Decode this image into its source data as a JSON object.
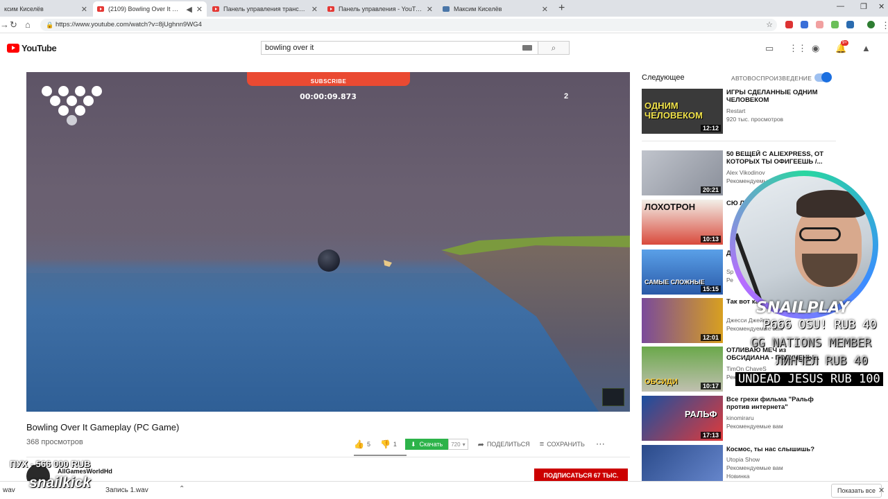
{
  "browser": {
    "tabs": [
      {
        "title": "ксим Киселёв"
      },
      {
        "title": "(2109) Bowling Over It Gam"
      },
      {
        "title": "Панель управления трансляция"
      },
      {
        "title": "Панель управления - YouTube"
      },
      {
        "title": "Максим Киселёв"
      }
    ],
    "tab_close": "✕",
    "new_tab": "+",
    "url": "https://www.youtube.com/watch?v=8jUghnn9WG4",
    "window_minimize": "—",
    "window_restore": "❐",
    "window_close": "✕"
  },
  "youtube": {
    "logo_text": "YouTube",
    "search_value": "bowling over it"
  },
  "player": {
    "subscribe_overlay": "SUBSCRIBE",
    "timer": "00:00:09.873",
    "score": "2"
  },
  "video": {
    "title": "Bowling Over It Gameplay (PC Game)",
    "views": "368 просмотров",
    "likes": "5",
    "dislikes": "1",
    "download_label": "Скачать",
    "download_count": "720",
    "share_label": "ПОДЕЛИТЬСЯ",
    "save_label": "СОХРАНИТЬ",
    "channel_name": "AllGamesWorldHd",
    "subscribe_label": "ПОДПИСАТЬСЯ 67 ТЫС."
  },
  "sidebar": {
    "next_heading": "Следующее",
    "autoplay_label": "АВТОВОСПРОИЗВЕДЕНИЕ",
    "items": [
      {
        "title": "ИГРЫ СДЕЛАННЫЕ ОДНИМ ЧЕЛОВЕКОМ",
        "channel": "Restart",
        "meta": "920 тыс. просмотров",
        "duration": "12:12",
        "thumb_text": "ОДНИМ ЧЕЛОВЕКОМ",
        "thumb_color": "#2a2a2a"
      },
      {
        "title": "50 ВЕЩЕЙ С ALIEXPRESS, ОТ КОТОРЫХ ТЫ ОФИГЕЕШЬ /...",
        "channel": "Alex Vikodinov",
        "meta": "Рекомендуемые вам",
        "duration": "20:21",
        "thumb_text": "",
        "thumb_color": "#b0b4c0"
      },
      {
        "title": "СЮ ЛО",
        "channel": "",
        "meta": "",
        "duration": "10:13",
        "thumb_text": "ЛОХОТРОН",
        "thumb_color": "#d94a3c"
      },
      {
        "title": "ДЕ",
        "channel": "Sp",
        "meta": "Ре",
        "duration": "15:15",
        "thumb_text": "САМЫЕ СЛОЖНЫЕ",
        "thumb_color": "#3a7ad0"
      },
      {
        "title": "Так вот ка Таноса",
        "channel": "Джесси Джеймс",
        "meta": "Рекомендуемые вам",
        "duration": "12:01",
        "thumb_text": "",
        "thumb_color": "#6a4a8a"
      },
      {
        "title": "ОТЛИВАЮ МЕЧ из ОБСИДИАНА - ПОЛУЧЕНЫ...",
        "channel": "TimOn ChaveS",
        "meta": "Реком",
        "duration": "10:17",
        "thumb_text": "ОБСИДИ",
        "thumb_color": "#4a7a3a"
      },
      {
        "title": "Все грехи фильма \"Ральф против интернета\"",
        "channel": "kinomiraru",
        "meta": "Рекомендуемые вам",
        "duration": "17:13",
        "thumb_text": "РАЛЬФ",
        "thumb_color": "#1a4fa0"
      },
      {
        "title": "Космос, ты нас слышишь?",
        "channel": "Utopia Show",
        "meta": "Рекомендуемые вам",
        "meta2": "Новинка",
        "duration": "",
        "thumb_text": "",
        "thumb_color": "#2a4a8a"
      }
    ]
  },
  "stream_overlay": {
    "logo": "SNAILPLAY",
    "donations": [
      "P666 OSU!  RUB 40",
      "GG NATIONS  MEMBER",
      "ЛИНЧЕЛ  RUB 40",
      "UNDEAD JESUS  RUB 100"
    ],
    "goal_text": "ПУХ - 566 000 RUB",
    "brand": "snailkick"
  },
  "downloads": {
    "items": [
      "wav",
      "Запись 1.wav"
    ],
    "show_all": "Показать все"
  }
}
